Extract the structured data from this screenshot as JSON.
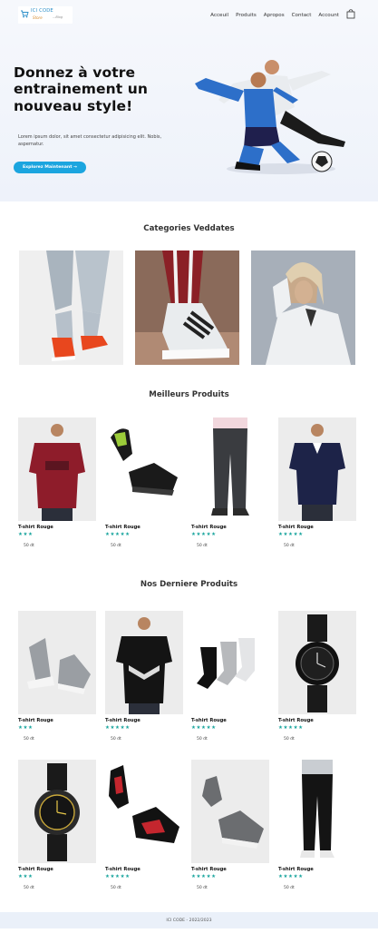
{
  "brand": {
    "name_top": "ICI CODE",
    "name_sub": "Store",
    "name_sub2": "...Blog"
  },
  "nav": {
    "items": [
      "Acceuil",
      "Produits",
      "Apropos",
      "Contact",
      "Account"
    ]
  },
  "hero": {
    "title": "Donnez à votre entrainement un nouveau style!",
    "text": "Lorem ipsum dolor, sit amet consectetur adipisicing elit. Nobis, aspernatur.",
    "cta_label": "Explorez Maintenant →"
  },
  "categories": {
    "title": "Categories Veddates"
  },
  "best": {
    "title": "Meilleurs Produits",
    "items": [
      {
        "name": "T-shirt Rouge",
        "stars": "★★★",
        "price": "50 dt"
      },
      {
        "name": "T-shirt Rouge",
        "stars": "★★★★★",
        "price": "50 dt"
      },
      {
        "name": "T-shirt Rouge",
        "stars": "★★★★★",
        "price": "50 dt"
      },
      {
        "name": "T-shirt Rouge",
        "stars": "★★★★★",
        "price": "50 dt"
      }
    ]
  },
  "latest": {
    "title": "Nos Derniere Produits",
    "items": [
      {
        "name": "T-shirt Rouge",
        "stars": "★★★",
        "price": "50 dt"
      },
      {
        "name": "T-shirt Rouge",
        "stars": "★★★★★",
        "price": "50 dt"
      },
      {
        "name": "T-shirt Rouge",
        "stars": "★★★★★",
        "price": "50 dt"
      },
      {
        "name": "T-shirt Rouge",
        "stars": "★★★★★",
        "price": "50 dt"
      },
      {
        "name": "T-shirt Rouge",
        "stars": "★★★",
        "price": "50 dt"
      },
      {
        "name": "T-shirt Rouge",
        "stars": "★★★★★",
        "price": "50 dt"
      },
      {
        "name": "T-shirt Rouge",
        "stars": "★★★★★",
        "price": "50 dt"
      },
      {
        "name": "T-shirt Rouge",
        "stars": "★★★★★",
        "price": "50 dt"
      }
    ]
  },
  "footer": {
    "text": "ICI CODE - 2022/2023"
  },
  "colors": {
    "accent": "#1ba5df",
    "stars": "#1aa59e",
    "hero_bg": "#eef2fa",
    "footer_bg": "#eaf0f9"
  }
}
